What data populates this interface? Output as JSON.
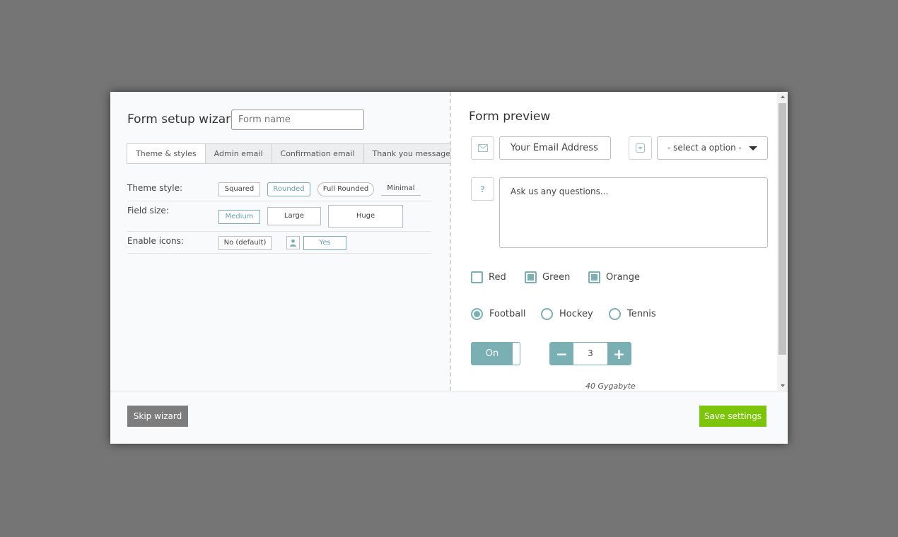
{
  "wizard": {
    "title": "Form setup wizard",
    "form_name_placeholder": "Form name"
  },
  "tabs": [
    {
      "label": "Theme & styles",
      "active": true
    },
    {
      "label": "Admin email",
      "active": false
    },
    {
      "label": "Confirmation email",
      "active": false
    },
    {
      "label": "Thank you message",
      "active": false
    }
  ],
  "options": {
    "theme_style": {
      "label": "Theme style:",
      "choices": [
        "Squared",
        "Rounded",
        "Full Rounded",
        "Minimal"
      ],
      "selected": "Rounded"
    },
    "field_size": {
      "label": "Field size:",
      "choices": [
        "Medium",
        "Large",
        "Huge"
      ],
      "selected": "Medium"
    },
    "enable_icons": {
      "label": "Enable icons:",
      "choices": [
        "No (default)",
        "Yes"
      ],
      "selected": "Yes"
    }
  },
  "preview": {
    "title": "Form preview",
    "email_placeholder": "Your Email Address",
    "select_value": "- select a option -",
    "question_placeholder": "Ask us any questions...",
    "question_icon": "?",
    "checkboxes": [
      {
        "label": "Red",
        "checked": false
      },
      {
        "label": "Green",
        "checked": true
      },
      {
        "label": "Orange",
        "checked": true
      }
    ],
    "radios": [
      {
        "label": "Football",
        "checked": true
      },
      {
        "label": "Hockey",
        "checked": false
      },
      {
        "label": "Tennis",
        "checked": false
      }
    ],
    "toggle_label": "On",
    "stepper": {
      "minus": "−",
      "value": "3",
      "plus": "+"
    },
    "storage_label": "40 Gygabyte"
  },
  "footer": {
    "skip_label": "Skip wizard",
    "save_label": "Save settings"
  },
  "colors": {
    "accent": "#7aafb4",
    "save_button": "#7cc50b",
    "skip_button": "#7d7d7d",
    "backdrop": "#757575"
  }
}
